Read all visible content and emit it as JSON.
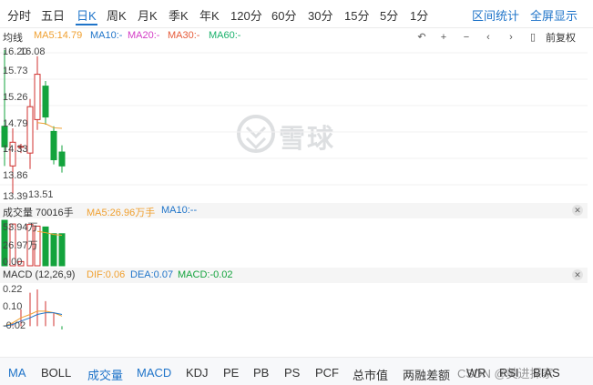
{
  "tabs": [
    "分时",
    "五日",
    "日K",
    "周K",
    "月K",
    "季K",
    "年K",
    "120分",
    "60分",
    "30分",
    "15分",
    "5分",
    "1分"
  ],
  "tab_links": {
    "range_stats": "区间统计",
    "fullscreen": "全屏显示"
  },
  "ma_bar": {
    "title": "均线",
    "ma5": "MA5:14.79",
    "ma10": "MA10:-",
    "ma20": "MA20:-",
    "ma30": "MA30:-",
    "ma60": "MA60:-",
    "adjust": "前复权"
  },
  "price_axis": {
    "p1": "16.20",
    "p1b": "16.08",
    "p2": "15.73",
    "p3": "15.26",
    "p4": "14.79",
    "p5": "14.33",
    "p6": "13.86",
    "p7": "13.39",
    "low": "13.51"
  },
  "watermark": "雪球",
  "volume_bar": {
    "title": "成交量 70016手",
    "ma5": "MA5:26.96万手",
    "ma10": "MA10:--"
  },
  "volume_axis": {
    "v1": "53.94万",
    "v2": "26.97万",
    "v3": "0.00"
  },
  "macd_bar": {
    "title": "MACD (12,26,9)",
    "dif": "DIF:0.06",
    "dea": "DEA:0.07",
    "macd": "MACD:-0.02"
  },
  "macd_axis": {
    "m1": "0.22",
    "m2": "0.10",
    "m3": "-0.02"
  },
  "indicators": [
    "MA",
    "BOLL",
    "成交量",
    "MACD",
    "KDJ",
    "PE",
    "PB",
    "PS",
    "PCF",
    "总市值",
    "两融差额",
    "WR",
    "RSI",
    "BIAS"
  ],
  "credit": "CSDN @美进探家",
  "colors": {
    "up": "#d0322f",
    "down": "#13a33c",
    "ma5": "#f0a030",
    "ma10": "#1f74c9",
    "ma20": "#d43cc6",
    "ma30": "#e65b3a",
    "ma60": "#19b16b",
    "blue": "#1f74c9"
  },
  "chart_data": [
    {
      "type": "candlestick",
      "title": "日K",
      "candles": [
        {
          "open": 14.72,
          "close": 14.32,
          "high": 16.2,
          "low": 13.95
        },
        {
          "open": 13.95,
          "close": 14.41,
          "high": 14.68,
          "low": 13.39
        },
        {
          "open": 14.33,
          "close": 14.33,
          "high": 14.38,
          "low": 14.2
        },
        {
          "open": 14.2,
          "close": 15.1,
          "high": 15.25,
          "low": 13.89
        },
        {
          "open": 14.85,
          "close": 15.73,
          "high": 16.08,
          "low": 14.65
        },
        {
          "open": 15.5,
          "close": 14.9,
          "high": 15.6,
          "low": 14.75
        },
        {
          "open": 14.62,
          "close": 14.07,
          "high": 14.72,
          "low": 13.98
        },
        {
          "open": 14.22,
          "close": 13.95,
          "high": 14.35,
          "low": 13.82
        }
      ],
      "ma5": [
        null,
        null,
        null,
        null,
        14.79,
        14.77,
        14.69,
        14.68
      ],
      "ylim": [
        13.39,
        16.2
      ]
    },
    {
      "type": "bar",
      "title": "成交量",
      "values": [
        53.9,
        49.5,
        5,
        49,
        47,
        46,
        38,
        38
      ],
      "ma5": [
        null,
        null,
        null,
        null,
        40.9,
        39.3,
        37.1,
        36.1
      ],
      "ylim": [
        0,
        53.94
      ],
      "unit": "万手"
    },
    {
      "type": "bar",
      "title": "MACD",
      "macd": [
        0,
        0.02,
        0.1,
        0.2,
        0.22,
        0.15,
        0.08,
        -0.02
      ],
      "dif": [
        0,
        0.02,
        0.05,
        0.07,
        0.09,
        0.09,
        0.08,
        0.06
      ],
      "dea": [
        0,
        0.01,
        0.03,
        0.05,
        0.07,
        0.08,
        0.08,
        0.07
      ],
      "ylim": [
        -0.02,
        0.22
      ]
    }
  ]
}
